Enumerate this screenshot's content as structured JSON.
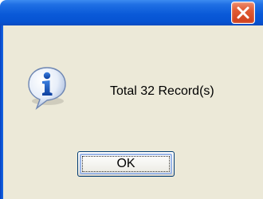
{
  "dialog": {
    "message": "Total 32 Record(s)",
    "ok_label": "OK",
    "icon": "info-icon",
    "close_icon": "close-icon"
  },
  "colors": {
    "titlebar": "#0a5ad8",
    "client_background": "#ece9d8",
    "close_button": "#e05a32",
    "button_border": "#003c74",
    "icon_blue": "#1b5fc0"
  }
}
